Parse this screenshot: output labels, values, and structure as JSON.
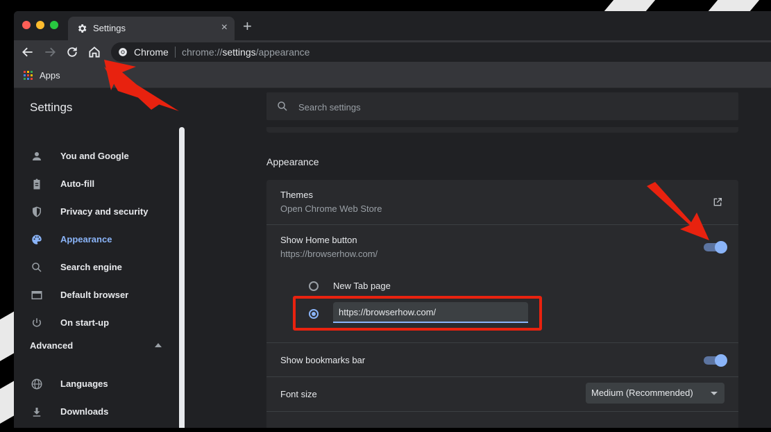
{
  "browser": {
    "tab_title": "Settings",
    "tab_close": "×",
    "new_tab": "+",
    "omnibox_site": "Chrome",
    "url_prefix": "chrome://",
    "url_bold": "settings",
    "url_suffix": "/appearance",
    "bookmark_apps": "Apps",
    "traffic_colors": [
      "#ff5f57",
      "#febc2e",
      "#28c840"
    ]
  },
  "settings": {
    "title": "Settings",
    "search_placeholder": "Search settings"
  },
  "sidebar": {
    "items": [
      {
        "label": "You and Google",
        "icon": "person-icon"
      },
      {
        "label": "Auto-fill",
        "icon": "clipboard-icon"
      },
      {
        "label": "Privacy and security",
        "icon": "shield-icon"
      },
      {
        "label": "Appearance",
        "icon": "palette-icon",
        "active": true
      },
      {
        "label": "Search engine",
        "icon": "search-icon"
      },
      {
        "label": "Default browser",
        "icon": "browser-icon"
      },
      {
        "label": "On start-up",
        "icon": "power-icon"
      }
    ],
    "advanced_label": "Advanced",
    "advanced_items": [
      {
        "label": "Languages",
        "icon": "globe-icon"
      },
      {
        "label": "Downloads",
        "icon": "download-icon"
      }
    ]
  },
  "appearance": {
    "section_title": "Appearance",
    "themes_title": "Themes",
    "themes_sub": "Open Chrome Web Store",
    "home_title": "Show Home button",
    "home_sub": "https://browserhow.com/",
    "home_enabled": true,
    "radio_new_tab": "New Tab page",
    "radio_custom_value": "https://browserhow.com/",
    "bookmarks_title": "Show bookmarks bar",
    "bookmarks_enabled": true,
    "font_size_title": "Font size",
    "font_size_value": "Medium (Recommended)"
  },
  "colors": {
    "accent": "#8ab4f8",
    "annotation": "#e8220f"
  }
}
